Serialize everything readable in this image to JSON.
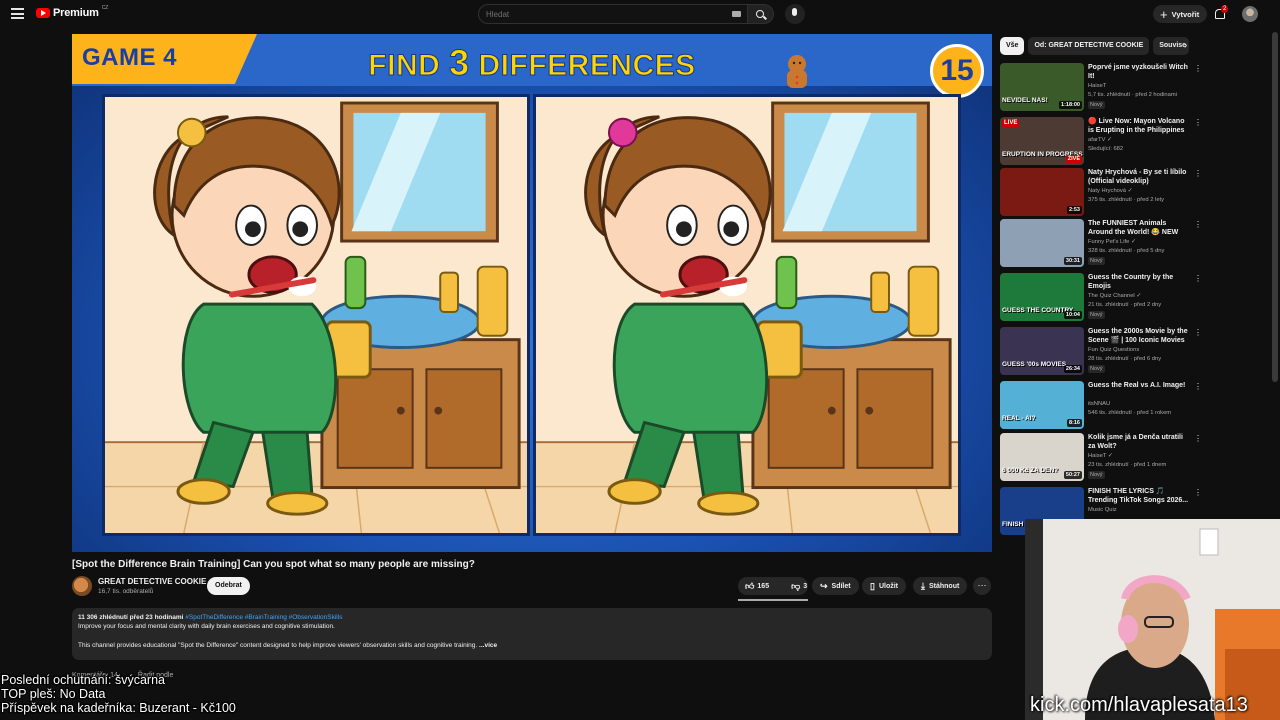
{
  "header": {
    "logo_text": "Premium",
    "logo_country": "CZ",
    "search_placeholder": "Hledat",
    "create_label": "Vytvořit",
    "notification_count": "2"
  },
  "video": {
    "game_label": "GAME 4",
    "title_prefix": "FIND ",
    "title_number": "3",
    "title_suffix": " DIFFERENCES",
    "timer": "15",
    "colors": {
      "accent_yellow": "#ffd400",
      "header_blue": "#2a67c9"
    }
  },
  "watch": {
    "title": "[Spot the Difference Brain Training] Can you spot what so many people are missing?",
    "channel_name": "GREAT DETECTIVE COOKIE",
    "channel_subs": "16,7 tis. odběratelů",
    "subscribe_label": "Odebrat",
    "like_count": "165",
    "dislike_count": "3",
    "share_label": "Sdílet",
    "save_label": "Uložit",
    "download_label": "Stáhnout"
  },
  "description": {
    "views_time": "11 306 zhlédnutí  před 23 hodinami ",
    "hashtags": "#SpotTheDifference #BrainTraining #ObservationSkills",
    "line1": "Improve your focus and mental clarity with daily brain exercises and cognitive stimulation.",
    "line2": "This channel provides educational \"Spot the Difference\" content designed to help improve viewers' observation skills and cognitive training.",
    "more_label": "...více"
  },
  "comments": {
    "count_label": "Komentáře: 14",
    "sort_label": "Řadit podle"
  },
  "overlay": {
    "line1": "Poslední ochutnání: švýcarna",
    "line2": "TOP pleš: No Data",
    "line3": "Příspěvek na kadeřníka: Buzerant - Kč100"
  },
  "sidebar": {
    "chips": [
      "Vše",
      "Od: GREAT DETECTIVE COOKIE",
      "Souvise"
    ],
    "recommendations": [
      {
        "title": "Poprvé jsme vyzkoušeli Witch It!",
        "channel": "HaiseT",
        "stats": "5,7 tis. zhlédnutí · před 2 hodinami",
        "duration": "1:18:00",
        "badge": "Nový",
        "thumb_text": "NEVIDEL NAS!",
        "thumb_color": "#3b5a2a"
      },
      {
        "title": "🔴 Live Now: Mayon Volcano is Erupting in the Philippines in 4...",
        "channel": "afarTV ✓",
        "stats": "Sledující: 682",
        "duration": "",
        "badge": "",
        "thumb_text": "ERUPTION IN PROGRESS",
        "thumb_color": "#4d3b33",
        "live": "LIVE",
        "live2": "ŽIVĚ"
      },
      {
        "title": "Naty Hrychová - By se ti líbilo (Official videoklip)",
        "channel": "Naty Hrychová ✓",
        "stats": "375 tis. zhlédnutí · před 2 lety",
        "duration": "2:53",
        "badge": "",
        "thumb_text": "",
        "thumb_color": "#7a1a12"
      },
      {
        "title": "The FUNNIEST Animals Around the World! 😂 NEW Funny ...",
        "channel": "Funny Pet's Life ✓",
        "stats": "328 tis. zhlédnutí · před 5 dny",
        "duration": "30:31",
        "badge": "Nový",
        "thumb_text": "",
        "thumb_color": "#8ea0b4"
      },
      {
        "title": "Guess the Country by the Emojis",
        "channel": "The Quiz Channel ✓",
        "stats": "21 tis. zhlédnutí · před 2 dny",
        "duration": "10:04",
        "badge": "Nový",
        "thumb_text": "GUESS THE COUNTRY",
        "thumb_color": "#1e7a3a"
      },
      {
        "title": "Guess the 2000s Movie by the Scene 🎬 | 100 Iconic Movies ...",
        "channel": "Fun Quiz Questions",
        "stats": "28 tis. zhlédnutí · před 6 dny",
        "duration": "26:34",
        "badge": "Nový",
        "thumb_text": "GUESS '00s MOVIES",
        "thumb_color": "#3a3352"
      },
      {
        "title": "Guess the Real vs A.I. Image!",
        "channel": "itsNNAU",
        "stats": "546 tis. zhlédnutí · před 1 rokem",
        "duration": "8:16",
        "badge": "",
        "thumb_text": "REAL - AI?",
        "thumb_color": "#55b0d6"
      },
      {
        "title": "Kolik jsme já a Denča utratili za Wolt?",
        "channel": "HaiseT ✓",
        "stats": "23 tis. zhlédnutí · před 1 dnem",
        "duration": "50:27",
        "badge": "Nový",
        "thumb_text": "6 000 Kč ZA DEN?",
        "thumb_color": "#d9d4cc"
      },
      {
        "title": "FINISH THE LYRICS 🎵 Trending TikTok Songs 2026...",
        "channel": "Music Quiz",
        "stats": "",
        "duration": "",
        "badge": "",
        "thumb_text": "FINISH THE LYRICS",
        "thumb_color": "#1a3f8a"
      }
    ]
  },
  "stream": {
    "kick_url": "kick.com/hlavaplesata13"
  }
}
